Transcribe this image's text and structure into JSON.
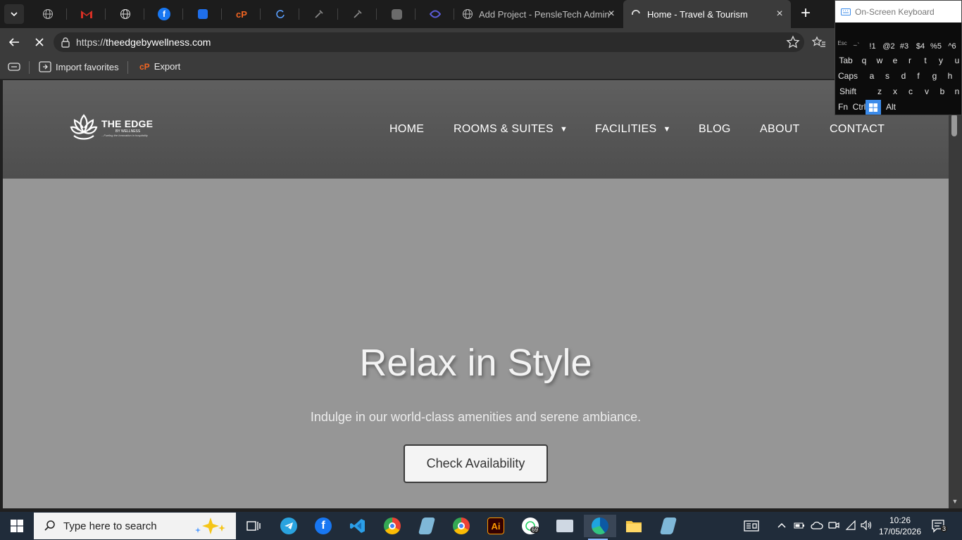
{
  "browser": {
    "pinned_tabs": [
      {
        "icon": "globe-icon"
      },
      {
        "icon": "gmail-icon",
        "color": "#d93025"
      },
      {
        "icon": "globe-icon"
      },
      {
        "icon": "facebook-icon",
        "color": "#1877f2"
      },
      {
        "icon": "app-icon-blue",
        "color": "#1f6feb"
      },
      {
        "icon": "cpanel-icon",
        "color": "#f26522"
      },
      {
        "icon": "refresh-app-icon"
      },
      {
        "icon": "tool-icon"
      },
      {
        "icon": "tool-icon"
      },
      {
        "icon": "openai-icon"
      },
      {
        "icon": "app-icon-purple",
        "color": "#5b5bd6"
      }
    ],
    "tabs": [
      {
        "title": "Add Project - PensleTech Admin",
        "active": false
      },
      {
        "title": "Home - Travel & Tourism",
        "active": true
      }
    ],
    "address": {
      "prefix": "https://",
      "host": "theedgebywellness.com"
    },
    "favorites": {
      "import_label": "Import favorites",
      "export_label": "Export"
    }
  },
  "site": {
    "logo": {
      "name": "THE EDGE",
      "sub": "BY WELLNESS",
      "tagline": "...Fueling the Innovation in hospitality"
    },
    "nav": [
      {
        "label": "HOME",
        "has_dropdown": false
      },
      {
        "label": "ROOMS & SUITES",
        "has_dropdown": true
      },
      {
        "label": "FACILITIES",
        "has_dropdown": true
      },
      {
        "label": "BLOG",
        "has_dropdown": false
      },
      {
        "label": "ABOUT",
        "has_dropdown": false
      },
      {
        "label": "CONTACT",
        "has_dropdown": false
      }
    ],
    "caret": "▼",
    "hero": {
      "title": "Relax in Style",
      "subtitle": "Indulge in our world-class amenities and serene ambiance.",
      "cta_label": "Check Availability"
    }
  },
  "osk": {
    "title": "On-Screen Keyboard",
    "rows": [
      [
        "Esc",
        "~`",
        "!1",
        "@2",
        "#3",
        "$4",
        "%5",
        "^6"
      ],
      [
        "Tab",
        "q",
        "w",
        "e",
        "r",
        "t",
        "y",
        "u"
      ],
      [
        "Caps",
        "a",
        "s",
        "d",
        "f",
        "g",
        "h"
      ],
      [
        "Shift",
        "z",
        "x",
        "c",
        "v",
        "b",
        "n"
      ],
      [
        "Fn",
        "Ctrl",
        "Alt"
      ]
    ]
  },
  "taskbar": {
    "search_placeholder": "Type here to search",
    "whatsapp_badge": "69",
    "clock_time": "10:26",
    "clock_date": "17/05/2026",
    "notification_count": "3"
  },
  "colors": {
    "accent": "#3b8bea",
    "page_bg": "#969696",
    "header_bg": "#575757",
    "taskbar_bg": "#202c3a"
  }
}
